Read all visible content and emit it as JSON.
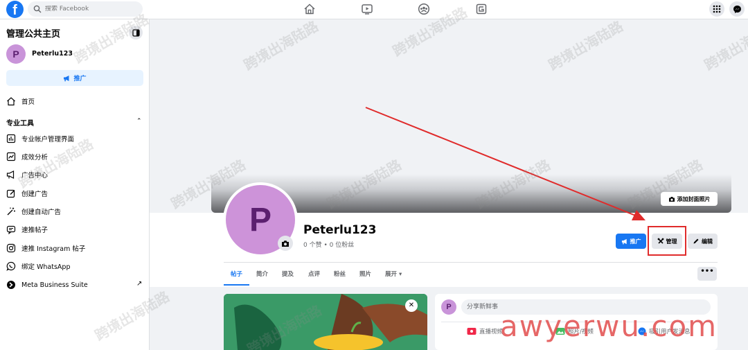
{
  "topbar": {
    "logo_letter": "f",
    "search_placeholder": "搜索 Facebook"
  },
  "sidebar": {
    "title": "管理公共主页",
    "page_avatar_letter": "P",
    "page_name": "Peterlu123",
    "promote_label": "推广",
    "home_label": "首页",
    "section_title": "专业工具",
    "items": [
      {
        "label": "专业帐户管理界面",
        "icon": "dashboard-icon"
      },
      {
        "label": "成效分析",
        "icon": "insights-icon"
      },
      {
        "label": "广告中心",
        "icon": "megaphone-icon"
      },
      {
        "label": "创建广告",
        "icon": "edit-icon"
      },
      {
        "label": "创建自动广告",
        "icon": "magic-wand-icon"
      },
      {
        "label": "速推帖子",
        "icon": "boost-post-icon"
      },
      {
        "label": "速推 Instagram 帖子",
        "icon": "instagram-icon"
      },
      {
        "label": "绑定 WhatsApp",
        "icon": "whatsapp-icon"
      },
      {
        "label": "Meta Business Suite",
        "icon": "meta-business-icon"
      }
    ]
  },
  "profile": {
    "avatar_letter": "P",
    "name": "Peterlu123",
    "stats": "0 个赞 • 0 位粉丝",
    "add_cover_label": "添加封面照片",
    "promote_label": "推广",
    "manage_label": "管理",
    "edit_label": "编辑",
    "more_label": "•••"
  },
  "tabs": [
    "帖子",
    "简介",
    "提及",
    "点评",
    "粉丝",
    "照片",
    "展开 ▾"
  ],
  "composer": {
    "avatar_letter": "P",
    "placeholder": "分享新鲜事",
    "actions": [
      "直播视频",
      "照片/视频",
      "吸引用户发消息"
    ]
  },
  "overlay": {
    "watermark_text": "跨境出海陆路",
    "url_watermark": "awyerwu.com"
  },
  "colors": {
    "brand_blue": "#1877f2",
    "annotation_red": "#e02b2b",
    "avatar_purple": "#cd93d9"
  }
}
